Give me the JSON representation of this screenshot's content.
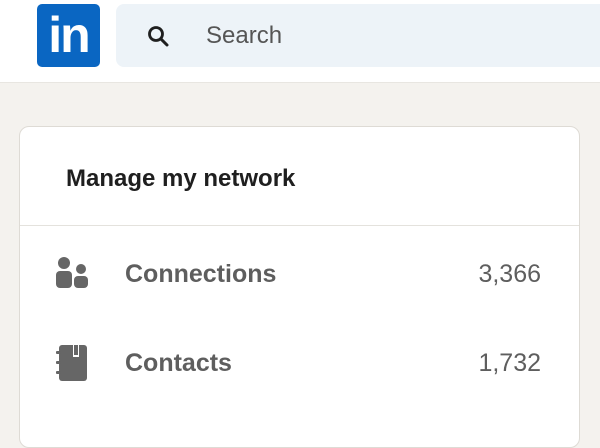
{
  "header": {
    "logo_text": "in",
    "search": {
      "placeholder": "Search",
      "icon": "search-icon"
    }
  },
  "colors": {
    "brand": "#0a66c2",
    "page_background": "#f4f2ee",
    "card_background": "#ffffff",
    "muted_text": "#5e5e5e"
  },
  "network_card": {
    "title": "Manage my network",
    "items": [
      {
        "label": "Connections",
        "count": "3,366",
        "icon": "people-icon"
      },
      {
        "label": "Contacts",
        "count": "1,732",
        "icon": "contact-book-icon"
      }
    ]
  }
}
